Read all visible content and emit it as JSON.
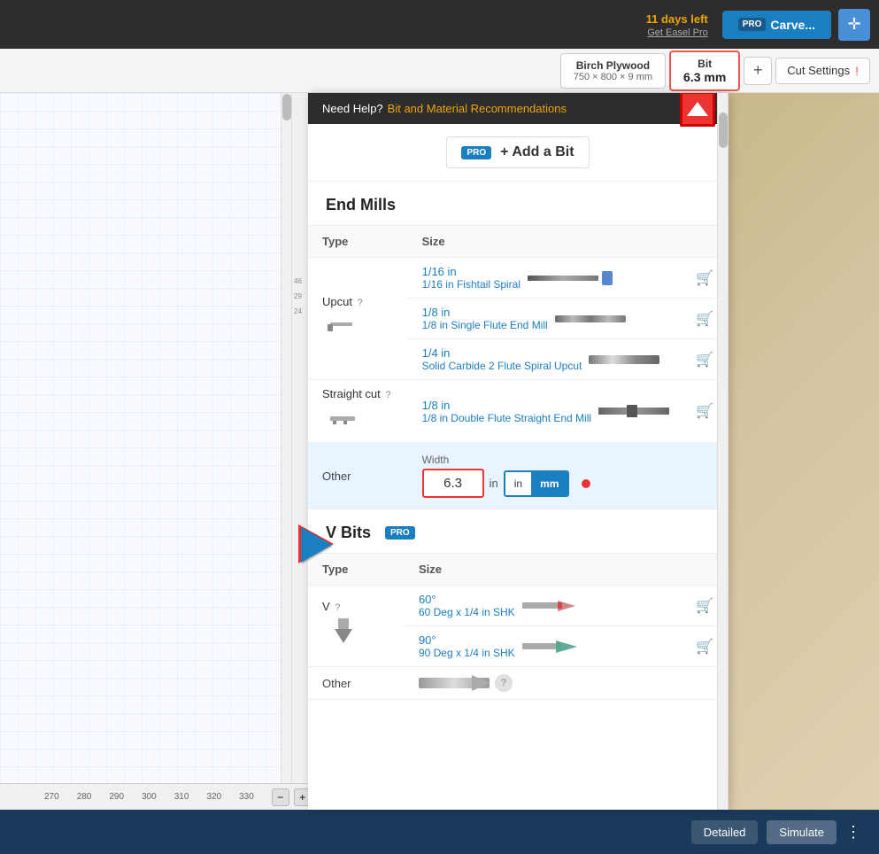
{
  "topbar": {
    "days_left": "11 days left",
    "get_easel": "Get Easel Pro",
    "pro_label": "PRO",
    "carve_label": "Carve...",
    "crosshair": "✛"
  },
  "secondbar": {
    "material_name": "Birch Plywood",
    "material_size": "750 × 800 × 9 mm",
    "bit_label": "Bit",
    "bit_size": "6.3 mm",
    "plus": "+",
    "cut_settings": "Cut Settings",
    "warning": "!"
  },
  "ruler": {
    "marks": [
      "46",
      "29",
      "24"
    ],
    "numbers": [
      "270",
      "280",
      "290",
      "300",
      "310",
      "320",
      "330"
    ],
    "minus": "−",
    "plus": "+",
    "home": "⌂"
  },
  "help_bar": {
    "need_help": "Need Help?",
    "link_text": "Bit and Material Recommendations"
  },
  "add_bit": {
    "pro": "PRO",
    "label": "+ Add a Bit"
  },
  "end_mills": {
    "section_title": "End Mills",
    "col_type": "Type",
    "col_size": "Size",
    "types": [
      {
        "name": "Upcut",
        "has_help": true,
        "bits": [
          {
            "size": "1/16 in",
            "name": "1/16 in Fishtail Spiral",
            "has_cart": true
          },
          {
            "size": "1/8 in",
            "name": "1/8 in Single Flute End Mill",
            "has_cart": true
          },
          {
            "size": "1/4 in",
            "name": "Solid Carbide 2 Flute Spiral Upcut",
            "has_cart": true
          }
        ]
      },
      {
        "name": "Straight cut",
        "has_help": true,
        "bits": [
          {
            "size": "1/8 in",
            "name": "1/8 in Double Flute Straight End Mill",
            "has_cart": true
          }
        ]
      },
      {
        "name": "Other",
        "has_help": false,
        "is_other": true,
        "width_label": "Width",
        "width_value": "6.3",
        "unit_in": "in",
        "unit_mm": "mm",
        "active_unit": "mm"
      }
    ]
  },
  "v_bits": {
    "section_title": "V Bits",
    "pro": "PRO",
    "col_type": "Type",
    "col_size": "Size",
    "types": [
      {
        "name": "V",
        "has_help": true,
        "bits": [
          {
            "size": "60°",
            "name": "60 Deg x 1/4 in SHK",
            "has_cart": true
          },
          {
            "size": "90°",
            "name": "90 Deg x 1/4 in SHK",
            "has_cart": true
          }
        ]
      },
      {
        "name": "Other",
        "is_other": true
      }
    ]
  },
  "bottom_bar": {
    "detailed": "Detailed",
    "simulate": "Simulate",
    "more": "⋮"
  }
}
